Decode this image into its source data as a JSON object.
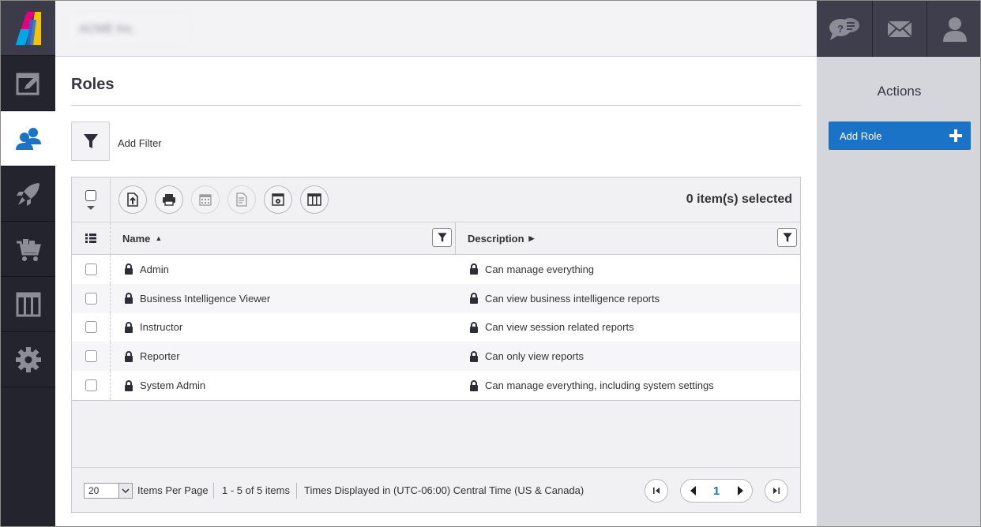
{
  "nav": {
    "items": [
      {
        "name": "content-editor-icon"
      },
      {
        "name": "users-icon",
        "active": true
      },
      {
        "name": "rocket-icon"
      },
      {
        "name": "cart-icon"
      },
      {
        "name": "columns-icon"
      },
      {
        "name": "gear-icon"
      }
    ]
  },
  "topbar": {
    "org_name": "ACME Inc.",
    "icons": [
      "help-chat-icon",
      "mail-icon",
      "user-profile-icon"
    ]
  },
  "page": {
    "title": "Roles",
    "add_filter_label": "Add Filter"
  },
  "grid": {
    "selected_count": "0 item(s) selected",
    "toolbar_icons": [
      "export-icon",
      "print-icon",
      "calendar-icon",
      "document-icon",
      "settings-window-icon",
      "columns-icon"
    ],
    "columns": [
      {
        "label": "Name",
        "sort": "asc"
      },
      {
        "label": "Description",
        "sort": "none"
      }
    ],
    "rows": [
      {
        "name": "Admin",
        "description": "Can manage everything"
      },
      {
        "name": "Business Intelligence Viewer",
        "description": "Can view business intelligence reports"
      },
      {
        "name": "Instructor",
        "description": "Can view session related reports"
      },
      {
        "name": "Reporter",
        "description": "Can only view reports"
      },
      {
        "name": "System Admin",
        "description": "Can manage everything, including system settings"
      }
    ]
  },
  "pager": {
    "page_size": "20",
    "items_per_page_label": "Items Per Page",
    "range_label": "1 - 5 of 5 items",
    "timezone_label": "Times Displayed in (UTC-06:00) Central Time (US & Canada)",
    "current_page": "1"
  },
  "actions": {
    "title": "Actions",
    "add_role_label": "Add Role"
  },
  "colors": {
    "nav_bg": "#24242f",
    "accent_blue": "#1a73c6",
    "side_panel_bg": "#d5d5dc"
  }
}
